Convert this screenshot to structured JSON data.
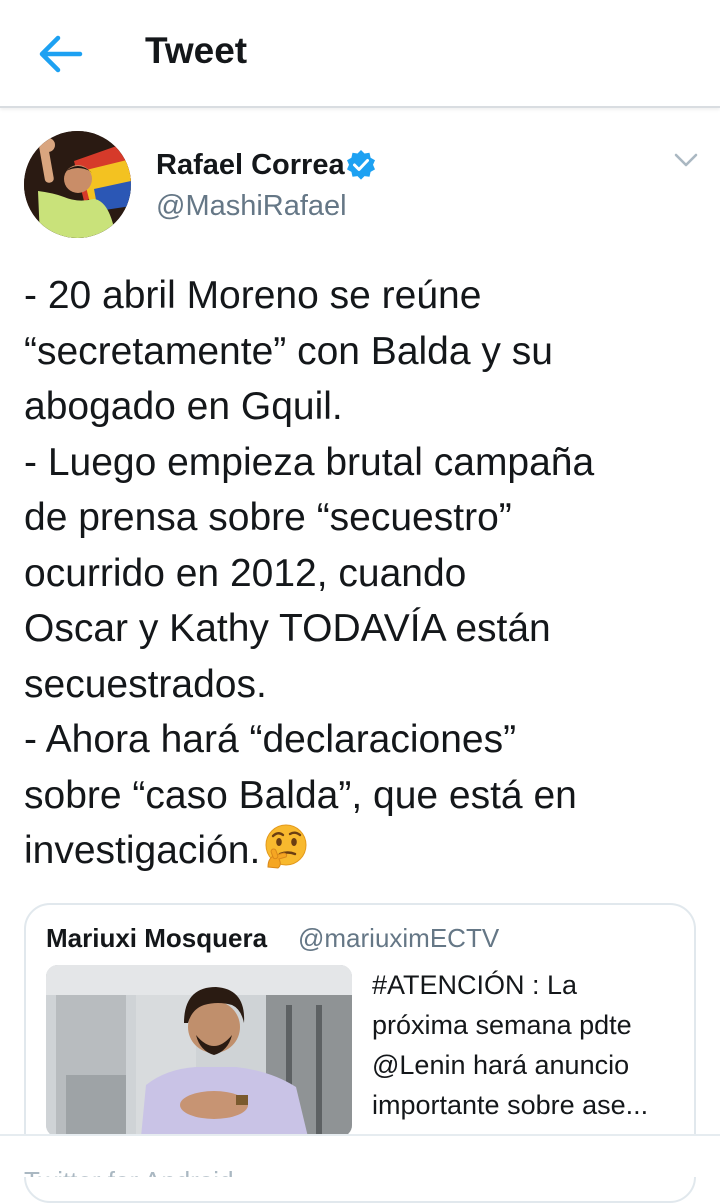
{
  "header": {
    "title": "Tweet",
    "back_icon": "arrow-left-icon",
    "accent_color": "#1da1f2"
  },
  "author": {
    "name": "Rafael Correa",
    "handle": "@MashiRafael",
    "verified": true,
    "verified_icon": "verified-badge-icon"
  },
  "tweet": {
    "lines": [
      "- 20 abril Moreno se reúne",
      "“secretamente” con Balda y su",
      "abogado en Gquil.",
      "- Luego empieza brutal campaña",
      "de prensa sobre “secuestro”",
      "ocurrido en 2012, cuando",
      "Oscar y Kathy TODAVÍA están",
      "secuestrados.",
      "- Ahora hará “declaraciones”",
      "sobre “caso Balda”, que está en",
      "investigación."
    ],
    "emoji": "thinking-face-icon"
  },
  "quoted_tweet": {
    "name": "Mariuxi Mosquera",
    "handle": "@mariuximECTV",
    "lines": [
      "#ATENCIÓN : La",
      "próxima semana pdte",
      "@Lenin hará anuncio",
      "importante sobre ase..."
    ]
  },
  "footer": {
    "text": "Twitter for Android"
  }
}
